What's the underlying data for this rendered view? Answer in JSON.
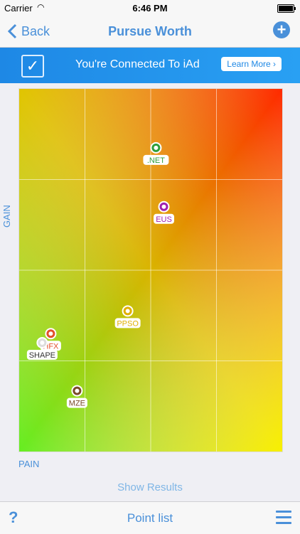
{
  "status_bar": {
    "carrier": "Carrier",
    "time": "6:46 PM"
  },
  "nav": {
    "back_label": "Back",
    "title": "Pursue Worth"
  },
  "banner": {
    "text": "You're Connected To iAd",
    "learn_more": "Learn More ›"
  },
  "axes": {
    "x_label": "PAIN",
    "y_label": "GAIN"
  },
  "colors": {
    "accent": "#4a90d9",
    "pin_green": "#2e9e3a",
    "pin_purple": "#a020b0",
    "pin_yellow": "#e0b000",
    "pin_red": "#e2502c",
    "pin_brown": "#7a4a2a"
  },
  "chart_data": {
    "type": "scatter",
    "xlabel": "PAIN",
    "ylabel": "GAIN",
    "xlim": [
      0,
      4
    ],
    "ylim": [
      0,
      4
    ],
    "grid": true,
    "points": [
      {
        "label": ".NET",
        "x": 2.08,
        "y": 3.35,
        "color": "#2e9e3a"
      },
      {
        "label": "EUS",
        "x": 2.2,
        "y": 2.7,
        "color": "#a020b0"
      },
      {
        "label": "PPSO",
        "x": 1.65,
        "y": 1.55,
        "color": "#e0b000"
      },
      {
        "label": "HFX",
        "x": 0.48,
        "y": 1.3,
        "color": "#e2502c"
      },
      {
        "label": "SHAPE",
        "x": 0.35,
        "y": 1.2,
        "color": "#ffffff"
      },
      {
        "label": "MZE",
        "x": 0.88,
        "y": 0.67,
        "color": "#7a4a2a"
      }
    ]
  },
  "footer": {
    "show_results": "Show Results",
    "point_list": "Point list",
    "help": "?"
  }
}
